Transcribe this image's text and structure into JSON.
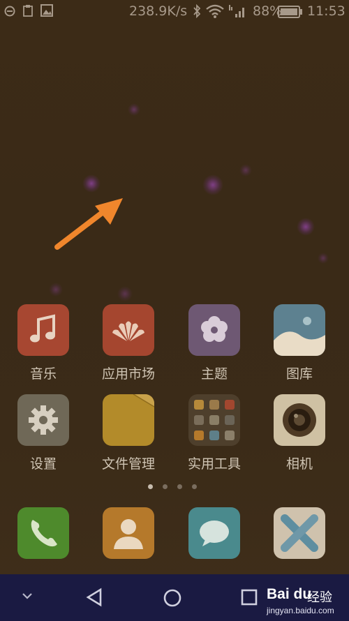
{
  "status_bar": {
    "net_speed": "238.9K/s",
    "battery_percent": "88%",
    "time": "11:53",
    "icons": [
      "notification-icon",
      "clipboard-icon",
      "image-icon",
      "bluetooth-icon",
      "wifi-icon",
      "signal-icon",
      "battery-icon"
    ]
  },
  "apps": [
    {
      "label": "音乐",
      "icon": "music-icon",
      "color": "#a74731"
    },
    {
      "label": "应用市场",
      "icon": "huawei-logo-icon",
      "color": "#a5462f"
    },
    {
      "label": "主题",
      "icon": "flower-icon",
      "color": "#6e5873"
    },
    {
      "label": "图库",
      "icon": "gallery-icon",
      "color": "#5d8190"
    },
    {
      "label": "设置",
      "icon": "gear-icon",
      "color": "#6f6857"
    },
    {
      "label": "文件管理",
      "icon": "folder-icon",
      "color": "#b38b2a"
    },
    {
      "label": "实用工具",
      "icon": "tools-folder-icon",
      "color": "#4e3f2c"
    },
    {
      "label": "相机",
      "icon": "camera-icon",
      "color": "#cfc1a3"
    }
  ],
  "dock": [
    {
      "icon": "phone-icon",
      "color": "#4e8a2c"
    },
    {
      "icon": "contacts-icon",
      "color": "#b5792b"
    },
    {
      "icon": "messages-icon",
      "color": "#4a8a8d"
    },
    {
      "icon": "browser-icon",
      "color": "#cfc2ad"
    }
  ],
  "pager": {
    "pages": 4,
    "active": 0
  },
  "nav": [
    "expand-down-icon",
    "back-icon",
    "home-icon",
    "recents-icon"
  ],
  "watermark": {
    "brand": "Bai du",
    "text": "经验",
    "url": "jingyan.baidu.com"
  },
  "annotation": {
    "color": "#f0862c"
  }
}
